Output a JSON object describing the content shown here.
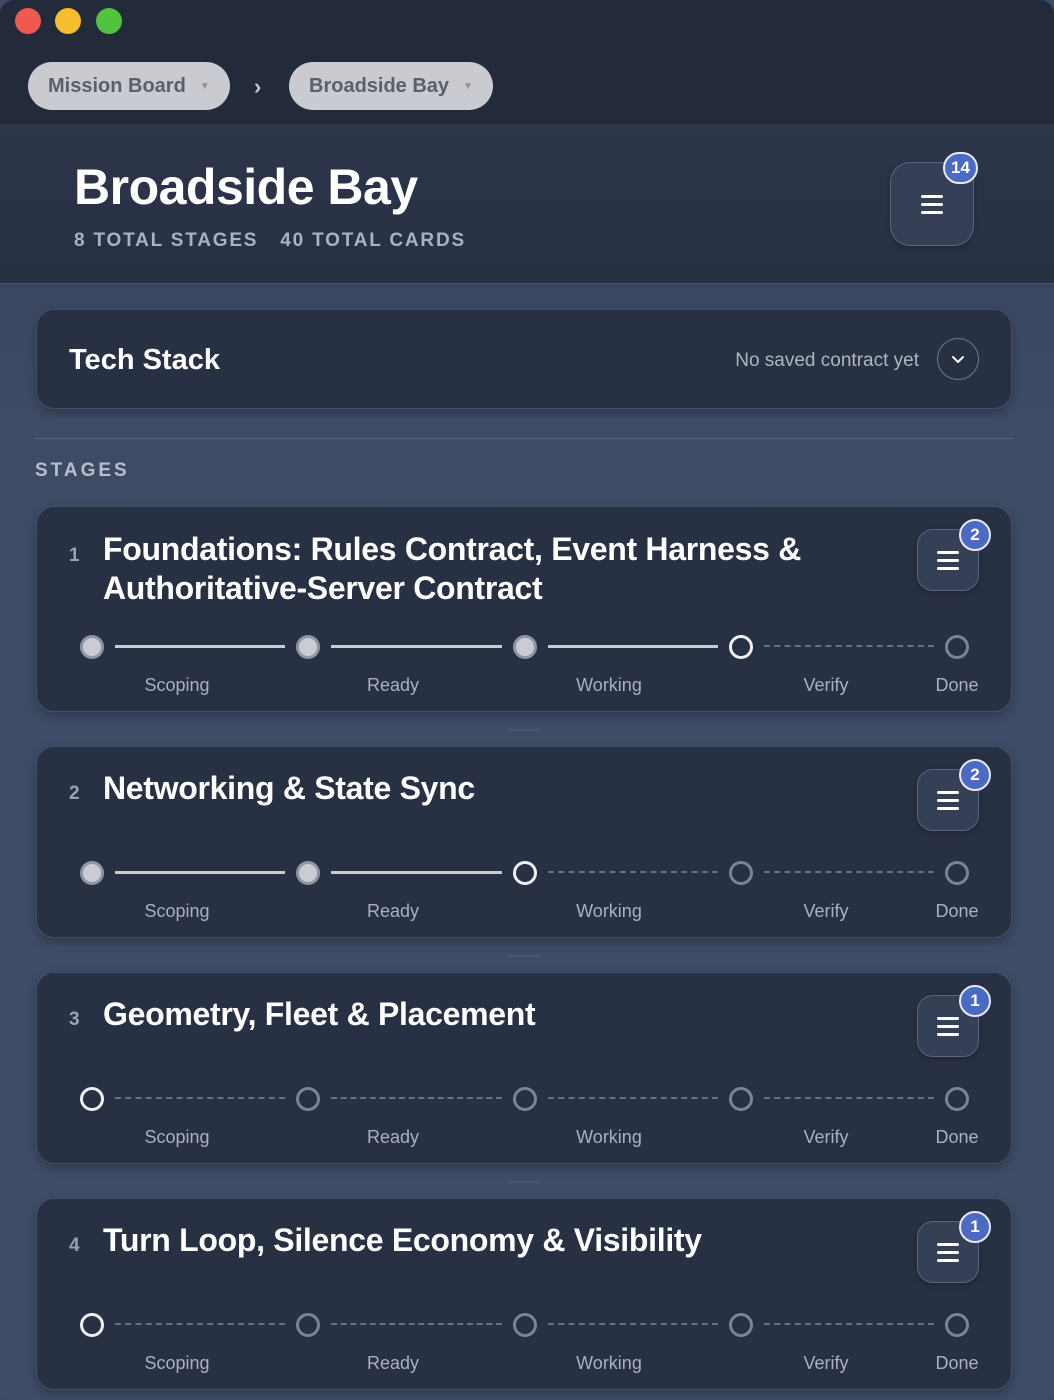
{
  "breadcrumb": {
    "items": [
      {
        "label": "Mission Board"
      },
      {
        "label": "Broadside Bay"
      }
    ],
    "separator": "›"
  },
  "header": {
    "title": "Broadside Bay",
    "stages_count": "8 TOTAL STAGES",
    "cards_count": "40 TOTAL CARDS",
    "menu_badge": "14"
  },
  "tech_stack": {
    "title": "Tech Stack",
    "status": "No saved contract yet"
  },
  "stages_section": {
    "label": "STAGES",
    "step_labels": [
      "Scoping",
      "Ready",
      "Working",
      "Verify",
      "Done"
    ],
    "stages": [
      {
        "number": "1",
        "title": "Foundations: Rules Contract, Event Harness & Authoritative-Server Contract",
        "badge": "2",
        "current_step": 3
      },
      {
        "number": "2",
        "title": "Networking & State Sync",
        "badge": "2",
        "current_step": 2
      },
      {
        "number": "3",
        "title": "Geometry, Fleet & Placement",
        "badge": "1",
        "current_step": 0
      },
      {
        "number": "4",
        "title": "Turn Loop, Silence Economy & Visibility",
        "badge": "1",
        "current_step": 0
      }
    ]
  },
  "colors": {
    "badge": "#4b6ac4",
    "window_bg": "#3d4a63",
    "card_bg": "#283044"
  }
}
